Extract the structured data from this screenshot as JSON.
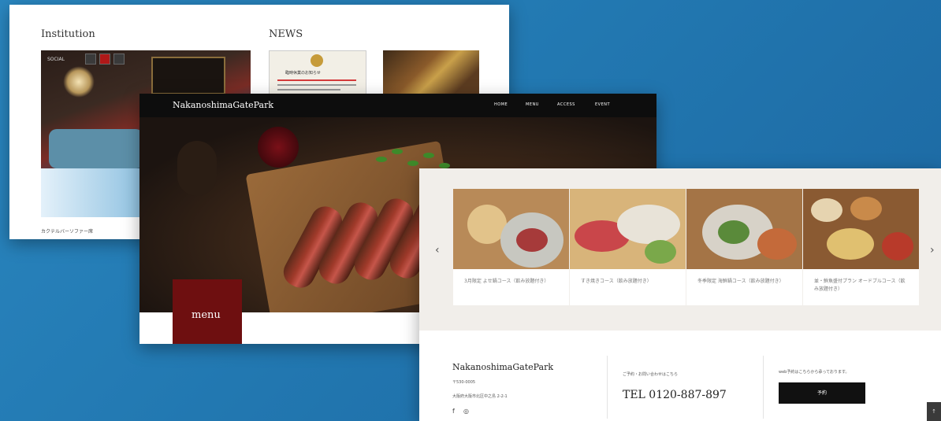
{
  "back_page": {
    "institution_title": "Institution",
    "news_title": "NEWS",
    "slider_label": "SOCIAL",
    "institution_caption": "カクテルバーソファー席",
    "news_card_heading": "臨時休業のお知らせ"
  },
  "main_page": {
    "brand": "NakanoshimaGatePark",
    "nav": [
      "HOME",
      "MENU",
      "ACCESS",
      "EVENT"
    ],
    "menu_label": "menu"
  },
  "front_page": {
    "carousel_prev": "‹",
    "carousel_next": "›",
    "cards": [
      {
        "caption": "3月限定 よせ鍋コース（飲み放題付き）"
      },
      {
        "caption": "すき焼きコース（飲み放題付き）"
      },
      {
        "caption": "冬季限定 海鮮鍋コース（飲み放題付き）"
      },
      {
        "caption": "並・鮮魚盛付プラン オードブルコース（飲み放題付き）"
      }
    ],
    "footer": {
      "brand": "NakanoshimaGatePark",
      "zip": "〒530-0005",
      "address": "大阪府大阪市北区中之島 2-2-1",
      "sns": [
        "f",
        "◎"
      ],
      "tel_note": "ご予約・お問い合わせはこちら",
      "tel": "TEL 0120-887-897",
      "web_note": "web予約はこちらから承っております。",
      "reserve_label": "予約"
    },
    "scroll_top": "↑"
  },
  "colors": {
    "background": "#2278b1",
    "menu_box": "#6e0f10",
    "nav_bar": "#0d0d0d"
  }
}
